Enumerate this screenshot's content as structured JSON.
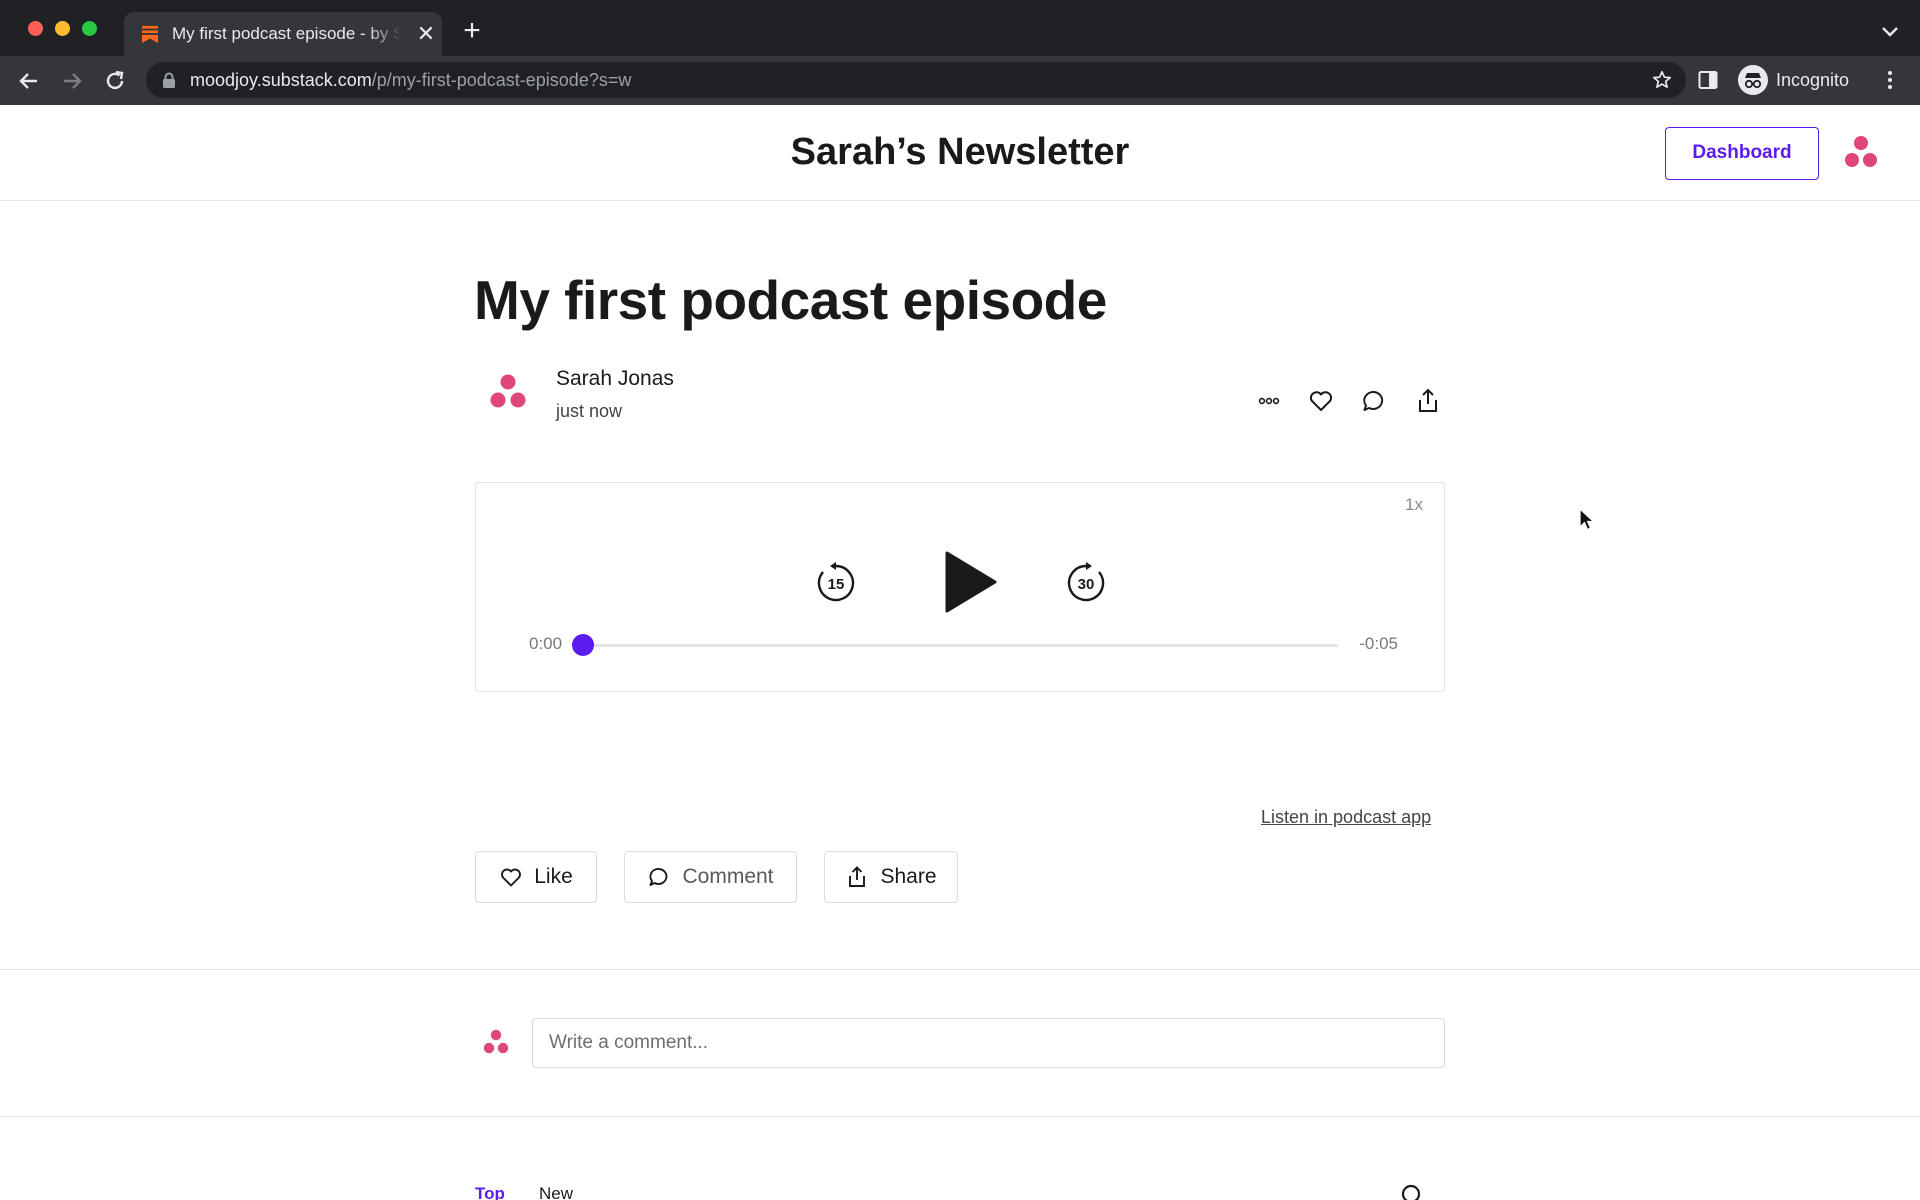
{
  "browser": {
    "tab_title": "My first podcast episode - by Sarah Jonas",
    "tab_close": "✕",
    "new_tab": "+",
    "url_host": "moodjoy.substack.com",
    "url_path": "/p/my-first-podcast-episode?s=w",
    "profile_label": "Incognito"
  },
  "header": {
    "site_title": "Sarah’s Newsletter",
    "dashboard_label": "Dashboard"
  },
  "post": {
    "title": "My first podcast episode",
    "author": "Sarah Jonas",
    "date": "just now"
  },
  "player": {
    "speed": "1x",
    "skip_back_seconds": "15",
    "skip_forward_seconds": "30",
    "current_time": "0:00",
    "remaining_time": "-0:05",
    "progress": 0.0,
    "listen_link": "Listen in podcast app"
  },
  "actions": {
    "like_label": "Like",
    "comment_label": "Comment",
    "share_label": "Share"
  },
  "comments": {
    "placeholder": "Write a comment...",
    "sort_tabs": [
      "Top",
      "New"
    ]
  },
  "colors": {
    "accent": "#5a1cf0",
    "avatar_dots": "#e0457b"
  }
}
